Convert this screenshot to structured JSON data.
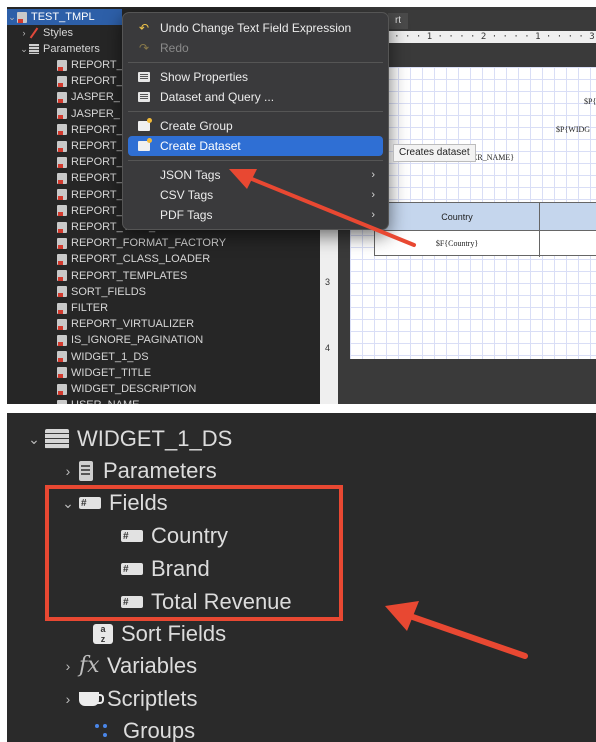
{
  "panel1": {
    "tree": {
      "root_label": "TEST_TMPL",
      "styles_label": "Styles",
      "parameters_label": "Parameters",
      "items": [
        "REPORT_",
        "REPORT_",
        "JASPER_",
        "JASPER_",
        "REPORT_",
        "REPORT_",
        "REPORT_",
        "REPORT_",
        "REPORT_",
        "REPORT_",
        "REPORT_TIME_ZONE",
        "REPORT_FORMAT_FACTORY",
        "REPORT_CLASS_LOADER",
        "REPORT_TEMPLATES",
        "SORT_FIELDS",
        "FILTER",
        "REPORT_VIRTUALIZER",
        "IS_IGNORE_PAGINATION",
        "WIDGET_1_DS",
        "WIDGET_TITLE",
        "WIDGET_DESCRIPTION",
        "USER_NAME"
      ]
    },
    "editor": {
      "tab_fragment": "rt",
      "ruler_top": "· · · 1 · · · · 1 · · · · 2 · · · · 1 · · · · 3 · · ·",
      "ruler_left": [
        "3",
        "4"
      ],
      "text_1": "$P{W",
      "text_2": "$P{WIDG",
      "text_3": "$P{USER_NAME}",
      "table_header": "Country",
      "table_cell": "$F{Country}"
    },
    "context_menu": {
      "items": [
        {
          "label": "Undo Change Text Field Expression",
          "icon": "undo-icon",
          "disabled": false
        },
        {
          "label": "Redo",
          "icon": "redo-icon",
          "disabled": true
        },
        {
          "label": "Show Properties",
          "icon": "properties-icon"
        },
        {
          "label": "Dataset and Query ...",
          "icon": "dataset-query-icon"
        },
        {
          "label": "Create Group",
          "icon": "group-icon"
        },
        {
          "label": "Create Dataset",
          "icon": "dataset-icon",
          "active": true
        },
        {
          "label": "JSON Tags",
          "submenu": true
        },
        {
          "label": "CSV Tags",
          "submenu": true
        },
        {
          "label": "PDF Tags",
          "submenu": true
        }
      ]
    },
    "tooltip": "Creates dataset"
  },
  "panel2": {
    "root_label": "WIDGET_1_DS",
    "parameters_label": "Parameters",
    "fields_label": "Fields",
    "fields": [
      "Country",
      "Brand",
      "Total Revenue"
    ],
    "sort_fields_label": "Sort Fields",
    "variables_label": "Variables",
    "scriptlets_label": "Scriptlets",
    "groups_label": "Groups"
  },
  "colors": {
    "highlight": "#e84832",
    "selection": "#2f6fd4",
    "panel_bg": "#2a2a2a"
  }
}
